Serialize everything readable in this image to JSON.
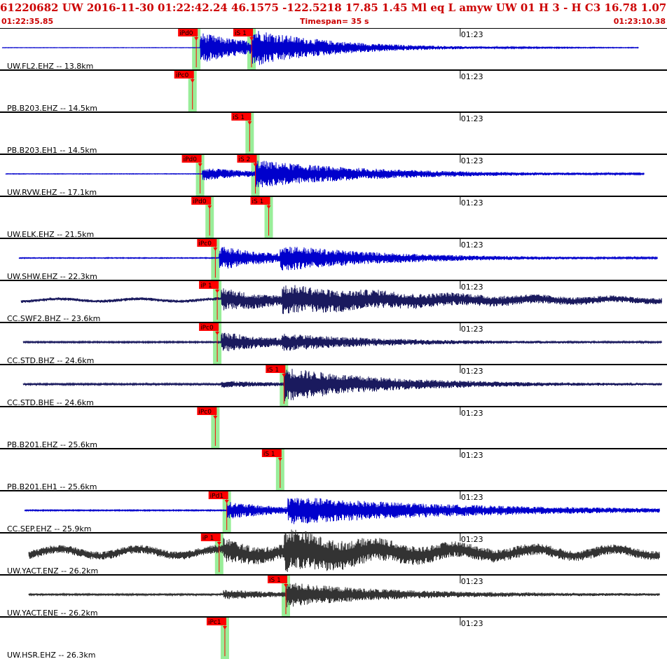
{
  "header": {
    "line1": "61220682 UW 2016-11-30 01:22:42.24   46.1575 -122.5218  17.85  1.45 Ml  eq  L amyw     UW 01  H   3  -  H C3   16.78  1.07",
    "start_time": "01:22:35.85",
    "timespan": "Timespan=  35 s",
    "end_time": "01:23:10.38"
  },
  "colors": {
    "header_text": "#cc0000",
    "trace_blue": "#0000cc",
    "trace_navy": "#1a1a5e",
    "trace_gray": "#333333",
    "pick": "#ff0000",
    "pick_window": "#99ee99",
    "separator": "#000000"
  },
  "chart_data": {
    "type": "line",
    "title": "61220682 UW 2016-11-30 01:22:42.24",
    "x_range_s": [
      0,
      35
    ],
    "time_tick_label": "01:23",
    "time_tick_s": 24.15,
    "stations": [
      {
        "label": "UW.FL2.EHZ -- 13.8km",
        "has_trace": true,
        "color": "blue",
        "p_pick": {
          "label": "iPd0",
          "t": 10.3
        },
        "s_pick": {
          "label": "iS 1",
          "t": 13.2
        },
        "trace": {
          "start": 0.1,
          "end": 33.5,
          "onset": 10.5,
          "amp_pre": 0.3,
          "amp_p": 22,
          "amp_s": 28,
          "decay": 4.0
        }
      },
      {
        "label": "PB.B203.EHZ -- 14.5km",
        "has_trace": false,
        "p_pick": {
          "label": "iPc0",
          "t": 10.1
        },
        "s_pick": null
      },
      {
        "label": "PB.B203.EH1 -- 14.5km",
        "has_trace": false,
        "p_pick": null,
        "s_pick": {
          "label": "iS 1",
          "t": 13.1
        }
      },
      {
        "label": "UW.RVW.EHZ -- 17.1km",
        "has_trace": true,
        "color": "blue",
        "p_pick": {
          "label": "iPd0",
          "t": 10.5
        },
        "s_pick": {
          "label": "iS 2",
          "t": 13.4
        },
        "trace": {
          "start": 0.3,
          "end": 33.8,
          "onset": 10.6,
          "amp_pre": 0.4,
          "amp_p": 9,
          "amp_s": 20,
          "decay": 6.0
        }
      },
      {
        "label": "UW.ELK.EHZ -- 21.5km",
        "has_trace": false,
        "p_pick": {
          "label": "iPd0",
          "t": 11.0
        },
        "s_pick": {
          "label": "iS 1",
          "t": 14.1
        }
      },
      {
        "label": "UW.SHW.EHZ -- 22.3km",
        "has_trace": true,
        "color": "blue",
        "p_pick": {
          "label": "iPc0",
          "t": 11.3
        },
        "s_pick": null,
        "trace": {
          "start": 1.0,
          "end": 34.5,
          "onset": 11.5,
          "amp_pre": 0.6,
          "amp_p": 17,
          "amp_s": 19,
          "decay": 5.5
        }
      },
      {
        "label": "CC.SWF2.BHZ -- 23.6km",
        "has_trace": true,
        "color": "navy",
        "p_pick": {
          "label": "iP 1",
          "t": 11.4
        },
        "s_pick": null,
        "trace": {
          "start": 1.1,
          "end": 34.7,
          "onset": 11.6,
          "amp_pre": 2.2,
          "amp_p": 15,
          "amp_s": 19,
          "decay": 9.0
        }
      },
      {
        "label": "CC.STD.BHZ -- 24.6km",
        "has_trace": true,
        "color": "navy",
        "p_pick": {
          "label": "iPc0",
          "t": 11.4
        },
        "s_pick": null,
        "trace": {
          "start": 1.2,
          "end": 34.7,
          "onset": 11.6,
          "amp_pre": 1.0,
          "amp_p": 14,
          "amp_s": 12,
          "decay": 5.0
        }
      },
      {
        "label": "CC.STD.BHE -- 24.6km",
        "has_trace": true,
        "color": "navy",
        "p_pick": null,
        "s_pick": {
          "label": "iS 1",
          "t": 14.9
        },
        "trace": {
          "start": 1.2,
          "end": 34.7,
          "onset": 11.6,
          "amp_pre": 1.2,
          "amp_p": 4,
          "amp_s": 24,
          "decay": 5.0
        }
      },
      {
        "label": "PB.B201.EHZ -- 25.6km",
        "has_trace": false,
        "p_pick": {
          "label": "iPc0",
          "t": 11.3
        },
        "s_pick": null
      },
      {
        "label": "PB.B201.EH1 -- 25.6km",
        "has_trace": false,
        "p_pick": null,
        "s_pick": {
          "label": "iS 1",
          "t": 14.7
        }
      },
      {
        "label": "CC.SEP.EHZ -- 25.9km",
        "has_trace": true,
        "color": "blue",
        "p_pick": {
          "label": "iPd1",
          "t": 11.9
        },
        "s_pick": null,
        "trace": {
          "start": 1.3,
          "end": 34.6,
          "onset": 11.9,
          "amp_pre": 0.8,
          "amp_p": 12,
          "amp_s": 20,
          "decay": 9.0
        }
      },
      {
        "label": "UW.YACT.ENZ -- 26.2km",
        "has_trace": true,
        "color": "gray",
        "p_pick": {
          "label": "iP 1",
          "t": 11.5
        },
        "s_pick": null,
        "trace": {
          "start": 1.5,
          "end": 34.6,
          "onset": 11.7,
          "amp_pre": 6.0,
          "amp_p": 12,
          "amp_s": 26,
          "decay": 5.5
        }
      },
      {
        "label": "UW.YACT.ENE -- 26.2km",
        "has_trace": true,
        "color": "gray",
        "p_pick": null,
        "s_pick": {
          "label": "iS 1",
          "t": 15.0
        },
        "trace": {
          "start": 1.5,
          "end": 34.6,
          "onset": 11.7,
          "amp_pre": 1.5,
          "amp_p": 6,
          "amp_s": 17,
          "decay": 5.0
        }
      },
      {
        "label": "UW.HSR.EHZ -- 26.3km",
        "has_trace": false,
        "p_pick": {
          "label": "iPc1",
          "t": 11.8
        },
        "s_pick": null
      }
    ]
  }
}
